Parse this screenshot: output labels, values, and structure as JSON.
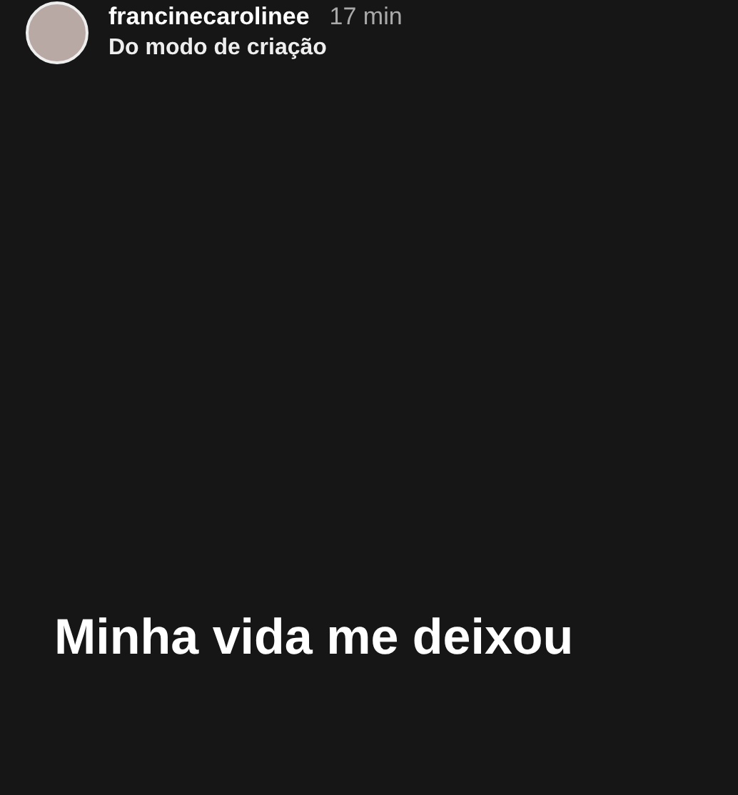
{
  "header": {
    "username": "francinecarolinee",
    "time": "17 min",
    "subtitle": "Do modo de criação"
  },
  "story": {
    "text": "Minha vida me deixou"
  }
}
